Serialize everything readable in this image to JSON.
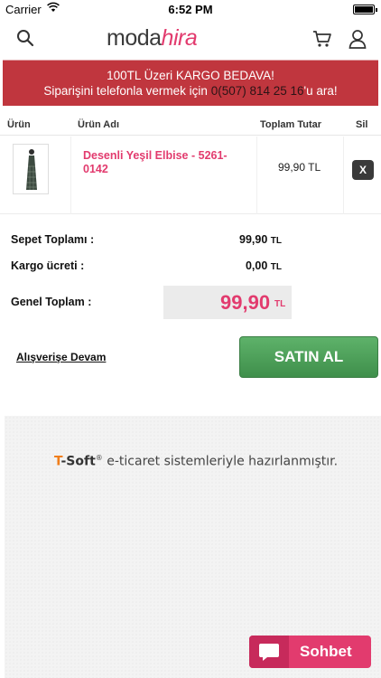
{
  "status_bar": {
    "carrier": "Carrier",
    "time": "6:52 PM"
  },
  "header": {
    "logo_primary": "moda",
    "logo_secondary": "hira"
  },
  "banner": {
    "line1": "100TL Üzeri KARGO BEDAVA!",
    "line2_prefix": "Siparişini telefonla vermek için ",
    "phone": "0(507) 814 25 16",
    "line2_suffix": "'u ara!"
  },
  "table": {
    "headers": {
      "product": "Ürün",
      "product_name": "Ürün Adı",
      "total": "Toplam Tutar",
      "delete": "Sil"
    },
    "items": [
      {
        "name": "Desenli Yeşil Elbise - 5261-0142",
        "price": "99,90 TL",
        "remove_label": "X"
      }
    ]
  },
  "totals": {
    "cart_total_label": "Sepet Toplamı :",
    "cart_total_value": "99,90",
    "shipping_label": "Kargo ücreti :",
    "shipping_value": "0,00",
    "grand_total_label": "Genel Toplam :",
    "grand_total_value": "99,90",
    "currency": "TL"
  },
  "actions": {
    "continue_label": "Alışverişe Devam",
    "buy_label": "SATIN AL"
  },
  "footer": {
    "brand_t": "T",
    "brand_rest": "-Soft",
    "registered": "®",
    "credit_text": " e-ticaret sistemleriyle hazırlanmıştır."
  },
  "chat": {
    "label": "Sohbet"
  },
  "colors": {
    "accent": "#e23b6e",
    "banner": "#c0363e",
    "buy_button": "#4c9d58",
    "brand_orange": "#f07e1b"
  }
}
